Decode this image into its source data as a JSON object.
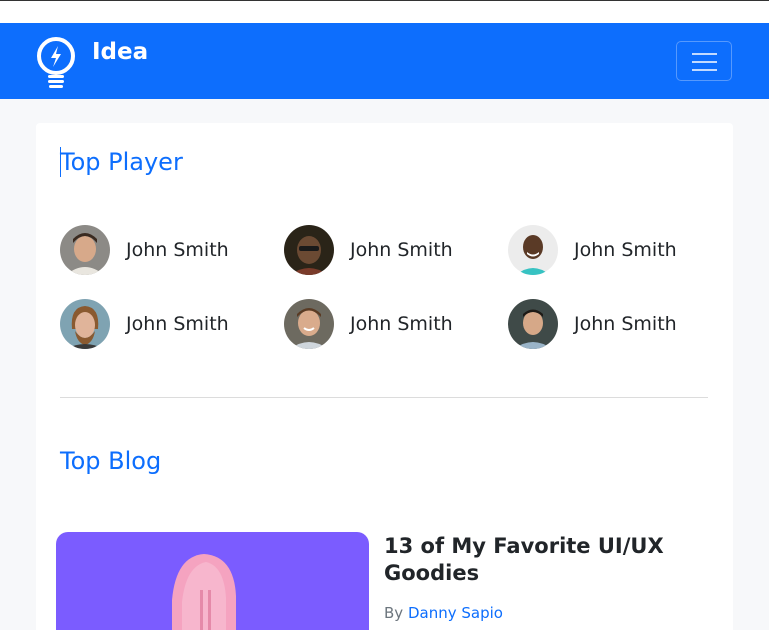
{
  "navbar": {
    "brand": "Idea",
    "logo_icon": "lightbulb-icon",
    "toggler_icon": "hamburger-menu-icon"
  },
  "players_section": {
    "title": "Top Player",
    "players": [
      {
        "name": "John Smith",
        "avatar": "avatar-photo-1"
      },
      {
        "name": "John Smith",
        "avatar": "avatar-photo-2"
      },
      {
        "name": "John Smith",
        "avatar": "avatar-photo-3"
      },
      {
        "name": "John Smith",
        "avatar": "avatar-photo-4"
      },
      {
        "name": "John Smith",
        "avatar": "avatar-photo-5"
      },
      {
        "name": "John Smith",
        "avatar": "avatar-photo-6"
      }
    ]
  },
  "blog_section": {
    "title": "Top Blog",
    "posts": [
      {
        "title": "13 of My Favorite UI/UX Goodies",
        "by_label": "By",
        "author": "Danny Sapio"
      }
    ]
  },
  "colors": {
    "primary": "#0d6efd",
    "page_bg": "#f7f8fa",
    "blog_image_bg": "#7b5cff"
  }
}
